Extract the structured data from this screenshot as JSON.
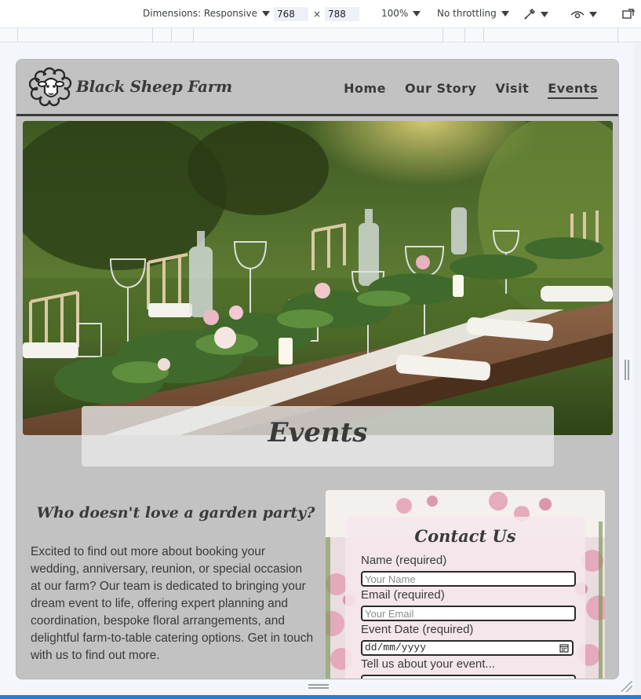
{
  "devtools": {
    "dimensions_label": "Dimensions: Responsive",
    "width_value": "768",
    "height_value": "788",
    "times_sign": "×",
    "zoom_label": "100%",
    "throttling_label": "No throttling"
  },
  "site": {
    "brand": "Black Sheep Farm",
    "nav": [
      "Home",
      "Our Story",
      "Visit",
      "Events"
    ],
    "active_nav": "Events",
    "hero_title": "Events"
  },
  "intro": {
    "heading": "Who doesn't love a garden party?",
    "text": "Excited to find out more about booking your wedding, anniversary, reunion, or special occasion at our farm? Our team is dedicated to bringing your dream event to life, offering expert planning and coordination, bespoke floral arrangements, and delightful farm-to-table catering options. Get in touch with us to find out more."
  },
  "contact": {
    "title": "Contact Us",
    "name_label": "Name (required)",
    "name_placeholder": "Your Name",
    "email_label": "Email (required)",
    "email_placeholder": "Your Email",
    "date_label": "Event Date (required)",
    "date_placeholder": "dd/mm/yyyy",
    "message_label": "Tell us about your event..."
  },
  "colors": {
    "page_bg": "#c2c2c2",
    "text": "#3a3a3a",
    "accent": "#2b7bd1"
  }
}
